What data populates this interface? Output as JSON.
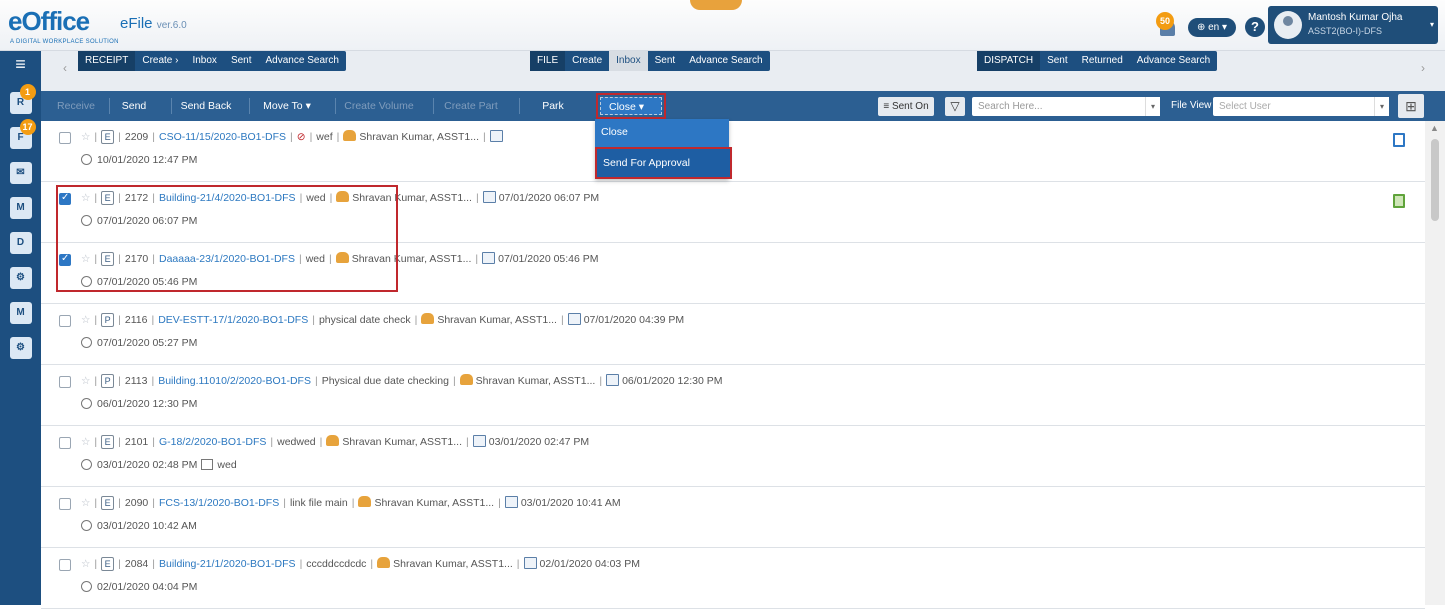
{
  "header": {
    "brand": "eOffice",
    "product": "eFile",
    "version": "ver.6.0",
    "tagline": "A DIGITAL WORKPLACE SOLUTION",
    "notif_count": "50",
    "lang": "en",
    "help": "?",
    "user_name": "Mantosh Kumar Ojha",
    "user_desig": "ASST2(BO-I)-DFS"
  },
  "sidebar": {
    "menu": "≡",
    "items": [
      {
        "label": "R",
        "badge": "1"
      },
      {
        "label": "F",
        "badge": "17"
      },
      {
        "label": "✉",
        "badge": ""
      },
      {
        "label": "M",
        "badge": ""
      },
      {
        "label": "D",
        "badge": ""
      },
      {
        "label": "⚙",
        "badge": ""
      },
      {
        "label": "M",
        "badge": ""
      },
      {
        "label": "⚙",
        "badge": ""
      }
    ]
  },
  "nav": {
    "receipt": {
      "title": "RECEIPT",
      "create": "Create ›",
      "inbox": "Inbox",
      "sent": "Sent",
      "search": "Advance Search"
    },
    "file": {
      "title": "FILE",
      "create": "Create",
      "inbox": "Inbox",
      "sent": "Sent",
      "search": "Advance Search"
    },
    "dispatch": {
      "title": "DISPATCH",
      "sent": "Sent",
      "returned": "Returned",
      "search": "Advance Search"
    }
  },
  "actions": {
    "receive": "Receive",
    "send": "Send",
    "send_back": "Send Back",
    "move_to": "Move To ▾",
    "create_volume": "Create Volume",
    "create_part": "Create Part",
    "park": "Park",
    "close": "Close ▾",
    "sent_on": "Sent On",
    "search_placeholder": "Search Here...",
    "file_view": "File View",
    "select_user": "Select User"
  },
  "dropdown": {
    "item1": "Close",
    "item2": "Send For Approval"
  },
  "rows": [
    {
      "checked": false,
      "type": "E",
      "num": "2209",
      "file": "CSO-11/15/2020-BO1-DFS",
      "subject": "wef",
      "user": "Shravan Kumar, ASST1...",
      "date1": "",
      "date2": "10/01/2020 12:47 PM",
      "extra": ""
    },
    {
      "checked": true,
      "type": "E",
      "num": "2172",
      "file": "Building-21/4/2020-BO1-DFS",
      "subject": "wed",
      "user": "Shravan Kumar, ASST1...",
      "date1": "07/01/2020 06:07 PM",
      "date2": "07/01/2020 06:07 PM",
      "extra": ""
    },
    {
      "checked": true,
      "type": "E",
      "num": "2170",
      "file": "Daaaaa-23/1/2020-BO1-DFS",
      "subject": "wed",
      "user": "Shravan Kumar, ASST1...",
      "date1": "07/01/2020 05:46 PM",
      "date2": "07/01/2020 05:46 PM",
      "extra": ""
    },
    {
      "checked": false,
      "type": "P",
      "num": "2116",
      "file": "DEV-ESTT-17/1/2020-BO1-DFS",
      "subject": "physical date check",
      "user": "Shravan Kumar, ASST1...",
      "date1": "07/01/2020 04:39 PM",
      "date2": "07/01/2020 05:27 PM",
      "extra": ""
    },
    {
      "checked": false,
      "type": "P",
      "num": "2113",
      "file": "Building.11010/2/2020-BO1-DFS",
      "subject": "Physical due date checking",
      "user": "Shravan Kumar, ASST1...",
      "date1": "06/01/2020 12:30 PM",
      "date2": "06/01/2020 12:30 PM",
      "extra": ""
    },
    {
      "checked": false,
      "type": "E",
      "num": "2101",
      "file": "G-18/2/2020-BO1-DFS",
      "subject": "wedwed",
      "user": "Shravan Kumar, ASST1...",
      "date1": "03/01/2020 02:47 PM",
      "date2": "03/01/2020 02:48 PM",
      "extra": "wed"
    },
    {
      "checked": false,
      "type": "E",
      "num": "2090",
      "file": "FCS-13/1/2020-BO1-DFS",
      "subject": "link file main",
      "user": "Shravan Kumar, ASST1...",
      "date1": "03/01/2020 10:41 AM",
      "date2": "03/01/2020 10:42 AM",
      "extra": ""
    },
    {
      "checked": false,
      "type": "E",
      "num": "2084",
      "file": "Building-21/1/2020-BO1-DFS",
      "subject": "cccddccdcdc",
      "user": "Shravan Kumar, ASST1...",
      "date1": "02/01/2020 04:03 PM",
      "date2": "02/01/2020 04:04 PM",
      "extra": ""
    }
  ]
}
